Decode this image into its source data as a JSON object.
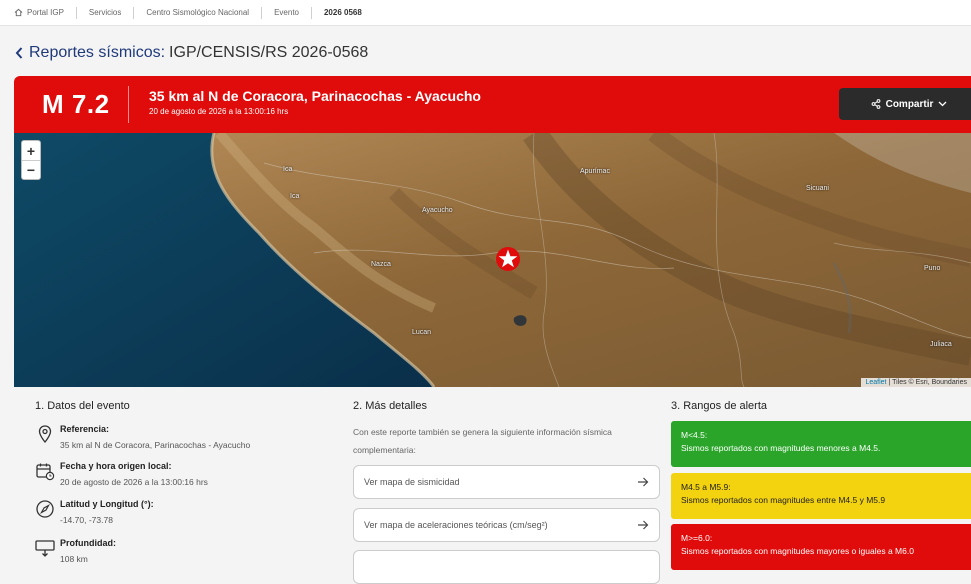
{
  "breadcrumb": {
    "items": [
      "Portal IGP",
      "Servicios",
      "Centro Sismológico Nacional",
      "Evento",
      "2026 0568"
    ]
  },
  "page": {
    "title": "Reportes sísmicos:",
    "code": "IGP/CENSIS/RS 2026-0568"
  },
  "event": {
    "magnitude": "M 7.2",
    "location": "35 km al N de Coracora, Parinacochas - Ayacucho",
    "datetime": "20 de agosto de 2026 a la 13:00:16 hrs",
    "share_label": "Compartir"
  },
  "map": {
    "zoom_in": "+",
    "zoom_out": "−",
    "cities": [
      "Ica",
      "Ica",
      "Ayacucho",
      "Apurímac",
      "Nazca",
      "Sicuani",
      "Puno",
      "Juliaca",
      "Lucan"
    ],
    "attribution_leaflet": "Leaflet",
    "attribution_rest": "| Tiles © Esri, Boundaries"
  },
  "details": {
    "section_title": "1. Datos del evento",
    "items": [
      {
        "icon": "location-pin-icon",
        "label": "Referencia:",
        "value": "35 km al N de Coracora, Parinacochas - Ayacucho"
      },
      {
        "icon": "calendar-clock-icon",
        "label": "Fecha y hora origen local:",
        "value": "20 de agosto de 2026 a la 13:00:16 hrs"
      },
      {
        "icon": "compass-icon",
        "label": "Latitud y Longitud (°):",
        "value": "-14.70, -73.78"
      },
      {
        "icon": "depth-icon",
        "label": "Profundidad:",
        "value": "108 km"
      }
    ]
  },
  "more": {
    "section_title": "2. Más detalles",
    "intro": "Con este reporte también se genera la siguiente información sísmica complementaria:",
    "links": [
      "Ver mapa de sismicidad",
      "Ver mapa de aceleraciones teóricas (cm/seg²)",
      ""
    ]
  },
  "alerts": {
    "section_title": "3. Rangos de alerta",
    "items": [
      {
        "range": "M<4.5:",
        "text": "Sismos reportados con magnitudes menores a M4.5.",
        "color": "#2aa52a"
      },
      {
        "range": "M4.5 a M5.9:",
        "text": "Sismos reportados con magnitudes entre M4.5 y M5.9",
        "color": "#f3d20f"
      },
      {
        "range": "M>=6.0:",
        "text": "Sismos reportados con magnitudes mayores o iguales a M6.0",
        "color": "#e00b0b"
      }
    ]
  },
  "colors": {
    "brand_red": "#e00b0b",
    "title_blue": "#1f3a7a",
    "dark_button": "#2b2b2b"
  }
}
